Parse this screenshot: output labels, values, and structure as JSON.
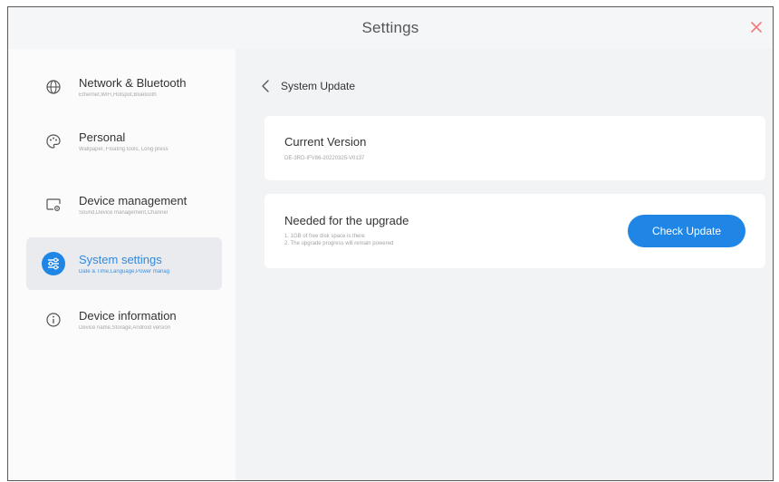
{
  "window": {
    "title": "Settings"
  },
  "sidebar": {
    "items": [
      {
        "label": "Network & Bluetooth",
        "sub": "Ethernet,WiFi,Hotspot,Bluetooth",
        "icon": "globe-icon",
        "active": false
      },
      {
        "label": "Personal",
        "sub": "Wallpaper, Floating tools, Long press",
        "icon": "palette-icon",
        "active": false
      },
      {
        "label": "Device management",
        "sub": "Sound,Device management,Channel",
        "icon": "device-icon",
        "active": false
      },
      {
        "label": "System settings",
        "sub": "Date & Time,Language,Power manag",
        "icon": "system-settings-icon",
        "active": true
      },
      {
        "label": "Device information",
        "sub": "Device name,Storage,Android version",
        "icon": "info-icon",
        "active": false
      }
    ]
  },
  "main": {
    "page_title": "System Update",
    "current_version": {
      "title": "Current Version",
      "value": "DE-3RD-IFV86-20220325-V0137"
    },
    "upgrade": {
      "title": "Needed for the upgrade",
      "notes": [
        "1. 1GB of free disk space is there",
        "2. The upgrade progress will remain powered"
      ],
      "button_label": "Check Update"
    }
  },
  "colors": {
    "accent": "#1f86e5",
    "active_bg": "#e9ebef",
    "close": "#f27a7a"
  }
}
